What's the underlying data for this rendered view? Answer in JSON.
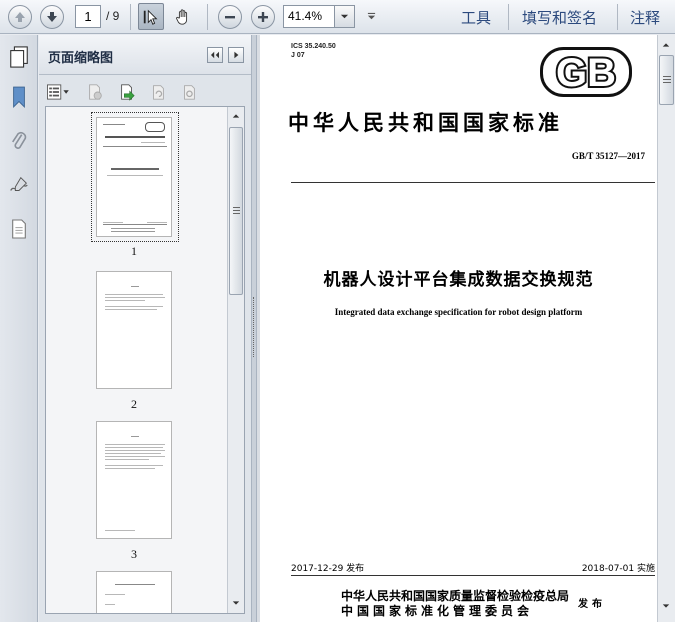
{
  "toolbar": {
    "current_page": "1",
    "page_total": "/ 9",
    "zoom": "41.4%",
    "tools_label": "工具",
    "sign_label": "填写和签名",
    "comment_label": "注释"
  },
  "panel": {
    "title": "页面缩略图",
    "thumbnails": [
      {
        "label": "1"
      },
      {
        "label": "2"
      },
      {
        "label": "3"
      }
    ]
  },
  "document": {
    "ics": "ICS 35.240.50",
    "ccs": "J 07",
    "logo_text": "GB",
    "standard_title": "中华人民共和国国家标准",
    "standard_number": "GB/T 35127—2017",
    "title_cn": "机器人设计平台集成数据交换规范",
    "title_en": "Integrated data exchange specification for robot design platform",
    "issue_date": "2017-12-29 发布",
    "implementation_date": "2018-07-01 实施",
    "issuer_line1": "中华人民共和国国家质量监督检验检疫总局",
    "issuer_line2": "中国国家标准化管理委员会",
    "publish_label": "发布"
  },
  "colors": {
    "toolbar_link": "#2c4a7e",
    "selected_tool": "#aab5c2"
  }
}
